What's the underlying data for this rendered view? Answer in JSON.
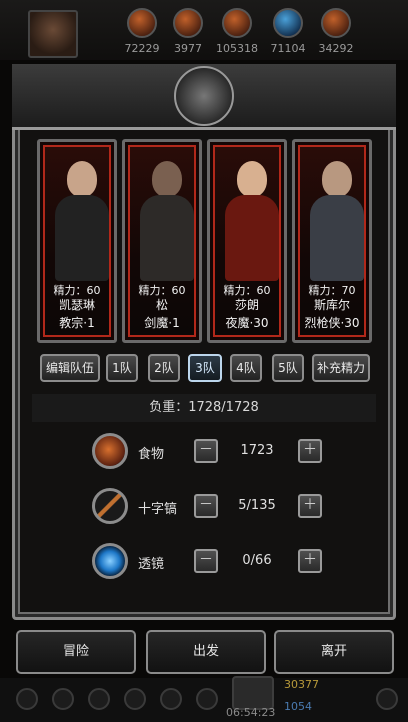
{
  "resources": [
    {
      "icon": "resource-icon",
      "value": "72229"
    },
    {
      "icon": "resource-icon",
      "value": "3977"
    },
    {
      "icon": "resource-icon",
      "value": "105318"
    },
    {
      "icon": "resource-icon",
      "value": "71104"
    },
    {
      "icon": "resource-icon",
      "value": "34292"
    }
  ],
  "characters": [
    {
      "energy": "精力：60",
      "name": "凯瑟琳",
      "class": "教宗·1"
    },
    {
      "energy": "精力：60",
      "name": "松",
      "class": "剑魔·1"
    },
    {
      "energy": "精力：60",
      "name": "莎朗",
      "class": "夜魔·30"
    },
    {
      "energy": "精力：70",
      "name": "斯库尔",
      "class": "烈枪侠·30"
    }
  ],
  "team_buttons": {
    "edit": "编辑队伍",
    "teams": [
      "1队",
      "2队",
      "3队",
      "4队",
      "5队"
    ],
    "selected_team": "3队",
    "refill": "补充精力"
  },
  "load": "负重：1728/1728",
  "supplies": [
    {
      "label": "食物",
      "value": "1723",
      "icon": "food-icon"
    },
    {
      "label": "十字镐",
      "value": "5/135",
      "icon": "pickaxe-icon"
    },
    {
      "label": "透镜",
      "value": "0/66",
      "icon": "lens-icon"
    }
  ],
  "actions": {
    "adventure": "冒险",
    "depart": "出发",
    "leave": "离开"
  },
  "footer": {
    "timer": "06:54:23",
    "currency_top": "30377",
    "currency_bottom": "1054"
  },
  "colors": {
    "card_border": "#b2281a",
    "selected_team": "#bcd6ec"
  }
}
